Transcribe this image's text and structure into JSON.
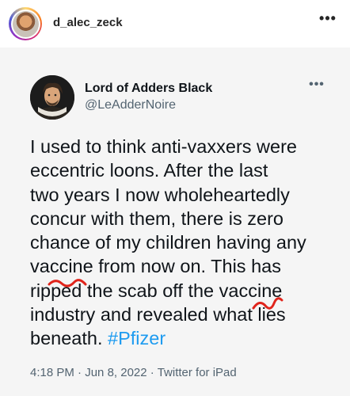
{
  "instagram": {
    "username": "d_alec_zeck",
    "more_icon": "more-horizontal-icon"
  },
  "tweet": {
    "display_name": "Lord of Adders Black",
    "handle": "@LeAdderNoire",
    "lines": [
      "I used to think anti-vaxxers were",
      "eccentric loons. After the last",
      "two years I now wholeheartedly",
      "concur with them, there is zero",
      "chance of my children having any",
      "vaccine from now on. This has",
      "ripped the scab off the vaccine",
      "industry and revealed what lies",
      "beneath. "
    ],
    "hashtag": "#Pfizer",
    "time": "4:18 PM",
    "separator": "·",
    "date": "Jun 8, 2022",
    "source": "Twitter for iPad"
  },
  "colors": {
    "hashtag": "#1d9bf0",
    "scribble": "#e0241b",
    "meta_text": "#536471",
    "card_bg": "#f5f5f5"
  }
}
